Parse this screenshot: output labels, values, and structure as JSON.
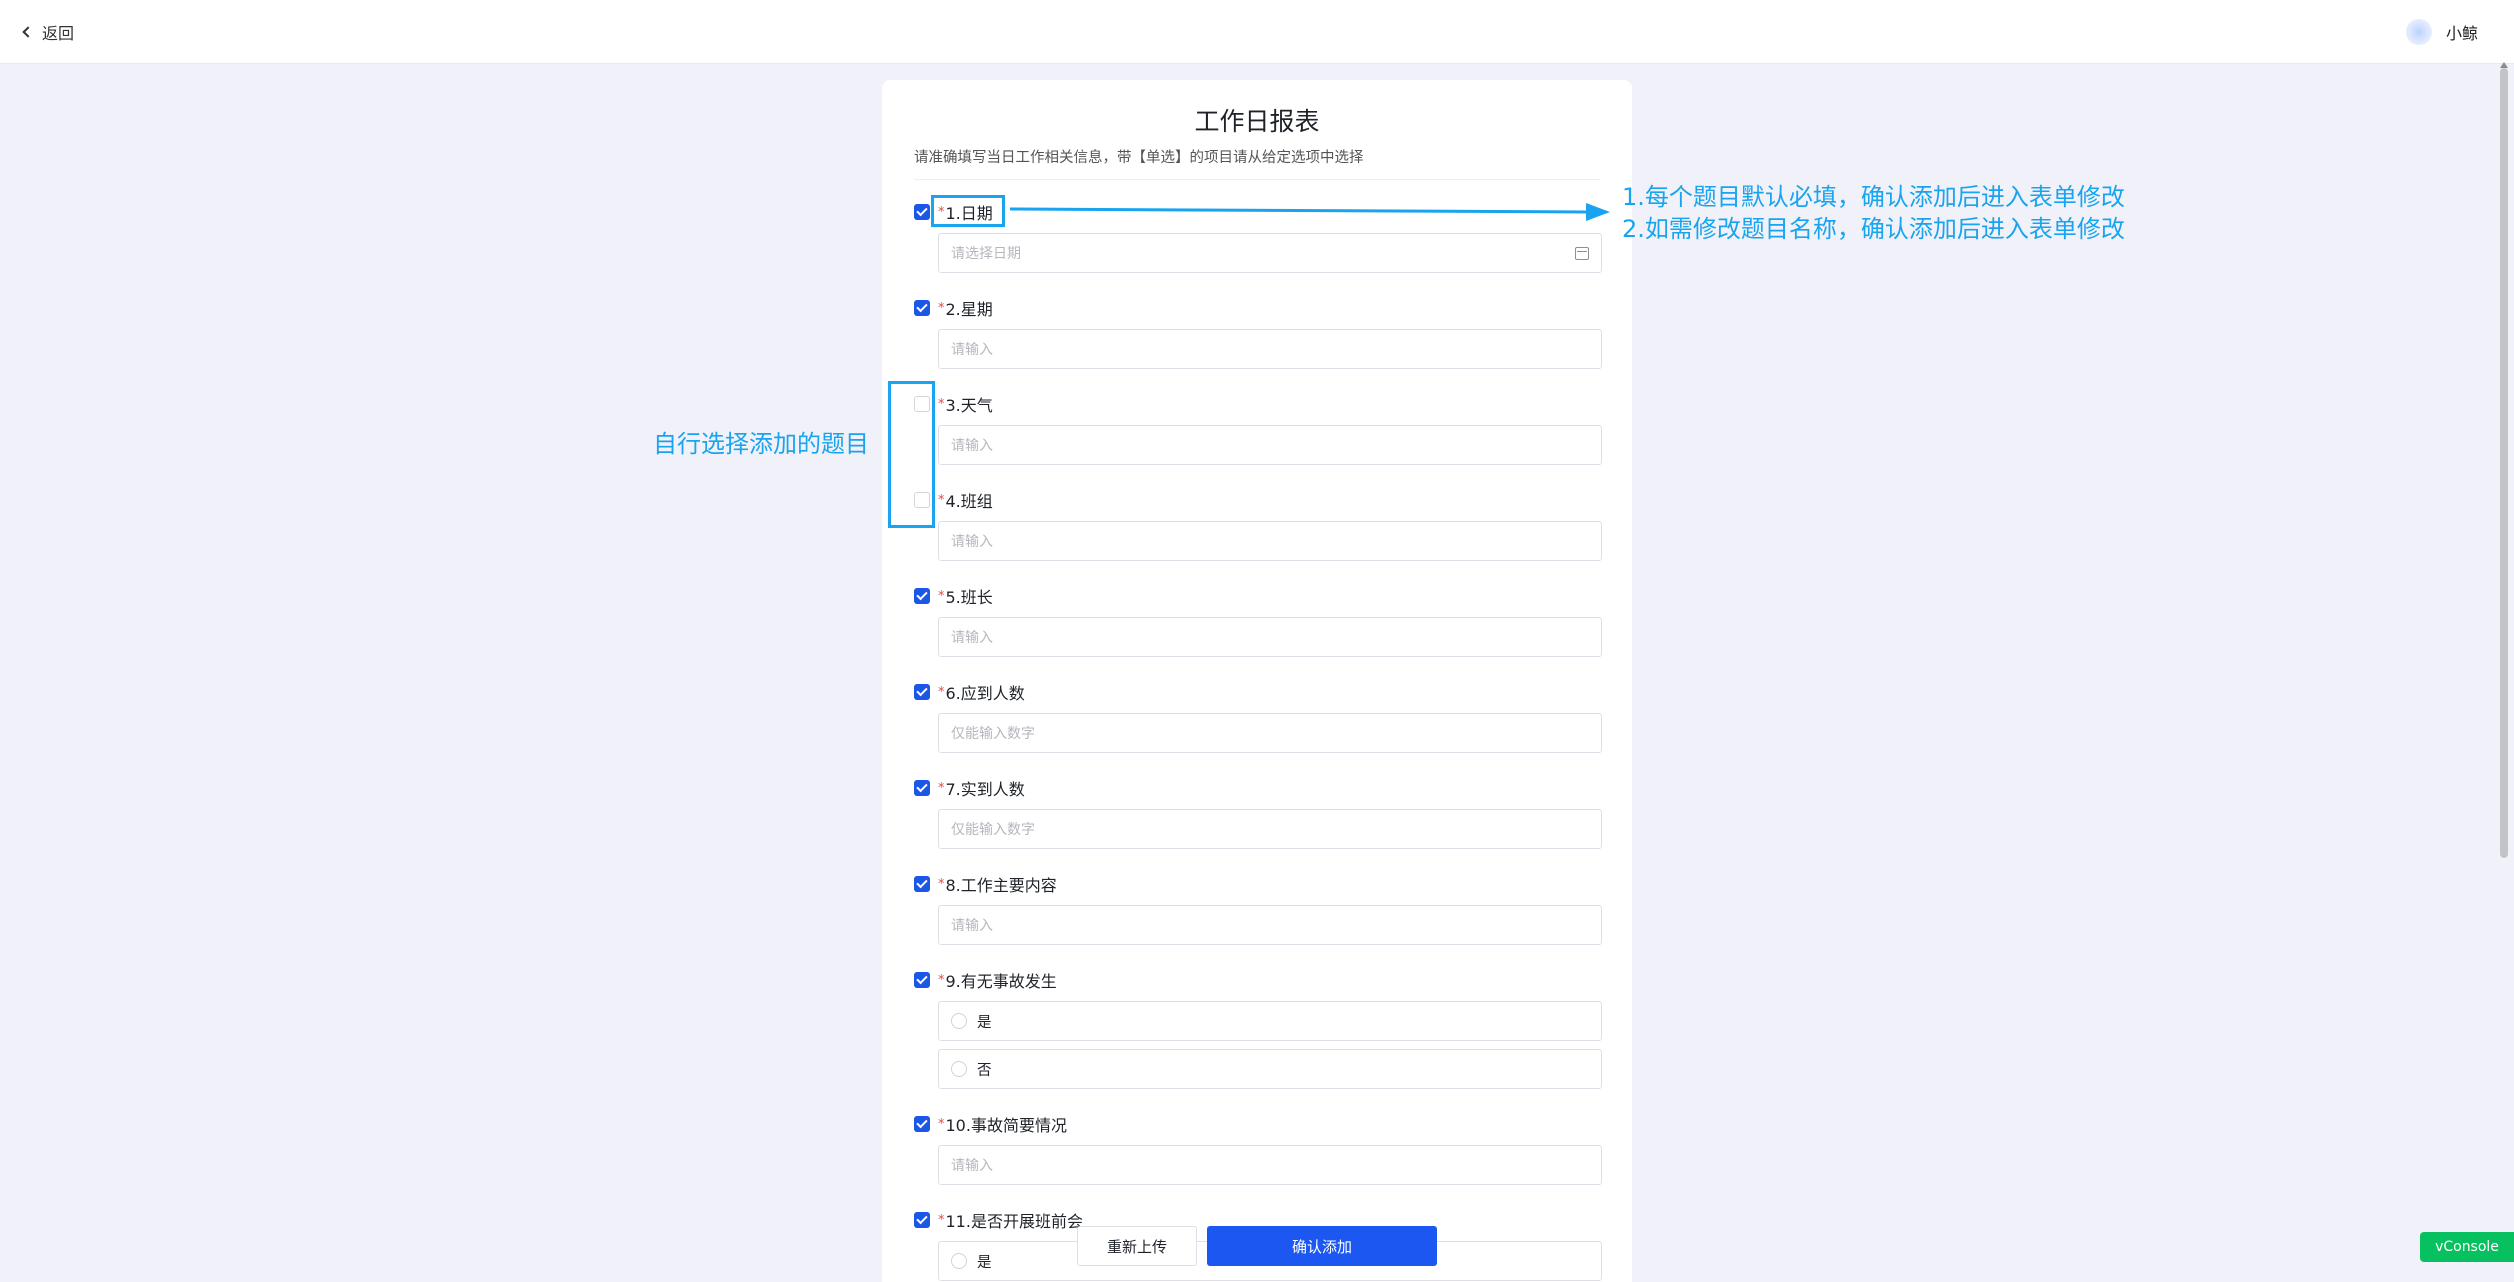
{
  "header": {
    "back_label": "返回",
    "user_name": "小鲸"
  },
  "form": {
    "title": "工作日报表",
    "description": "请准确填写当日工作相关信息，带【单选】的项目请从给定选项中选择",
    "required_mark": "*",
    "questions": [
      {
        "label": "1.日期",
        "checked": true,
        "type": "date",
        "placeholder": "请选择日期"
      },
      {
        "label": "2.星期",
        "checked": true,
        "type": "text",
        "placeholder": "请输入"
      },
      {
        "label": "3.天气",
        "checked": false,
        "type": "text",
        "placeholder": "请输入"
      },
      {
        "label": "4.班组",
        "checked": false,
        "type": "text",
        "placeholder": "请输入"
      },
      {
        "label": "5.班长",
        "checked": true,
        "type": "text",
        "placeholder": "请输入"
      },
      {
        "label": "6.应到人数",
        "checked": true,
        "type": "number",
        "placeholder": "仅能输入数字"
      },
      {
        "label": "7.实到人数",
        "checked": true,
        "type": "number",
        "placeholder": "仅能输入数字"
      },
      {
        "label": "8.工作主要内容",
        "checked": true,
        "type": "text",
        "placeholder": "请输入"
      },
      {
        "label": "9.有无事故发生",
        "checked": true,
        "type": "radio",
        "options": [
          "是",
          "否"
        ]
      },
      {
        "label": "10.事故简要情况",
        "checked": true,
        "type": "text",
        "placeholder": "请输入"
      },
      {
        "label": "11.是否开展班前会",
        "checked": true,
        "type": "radio",
        "options": [
          "是"
        ]
      }
    ]
  },
  "footer": {
    "reupload_label": "重新上传",
    "confirm_label": "确认添加"
  },
  "vconsole_label": "vConsole",
  "annotations": {
    "note_line1": "1.每个题目默认必填，确认添加后进入表单修改",
    "note_line2": "2.如需修改题目名称，确认添加后进入表单修改",
    "note_left": "自行选择添加的题目",
    "color": "#1aa3ef"
  },
  "colors": {
    "primary": "#1b57f0",
    "required": "#e5484d",
    "page_bg": "#f1f2f9",
    "vconsole": "#07c160"
  }
}
